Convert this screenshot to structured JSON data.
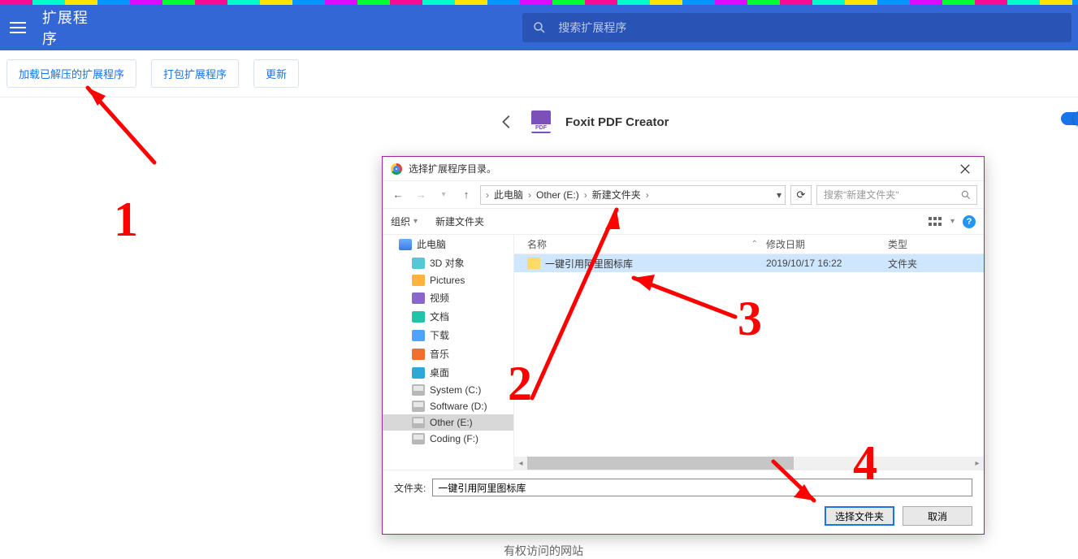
{
  "header": {
    "title": "扩展程序",
    "search_placeholder": "搜索扩展程序"
  },
  "action_bar": {
    "load_unpacked": "加载已解压的扩展程序",
    "pack": "打包扩展程序",
    "update": "更新"
  },
  "extension": {
    "name": "Foxit PDF Creator",
    "footer_text": "有权访问的网站"
  },
  "dialog": {
    "title": "选择扩展程序目录。",
    "path": {
      "seg1": "此电脑",
      "seg2": "Other (E:)",
      "seg3": "新建文件夹"
    },
    "search_placeholder": "搜索\"新建文件夹\"",
    "toolbar": {
      "organize": "组织",
      "new_folder": "新建文件夹"
    },
    "columns": {
      "name": "名称",
      "date": "修改日期",
      "type": "类型"
    },
    "tree": [
      {
        "icon": "ico-pc",
        "label": "此电脑",
        "indent": 1
      },
      {
        "icon": "ico-3d",
        "label": "3D 对象",
        "indent": 2
      },
      {
        "icon": "ico-pic",
        "label": "Pictures",
        "indent": 2
      },
      {
        "icon": "ico-vid",
        "label": "视频",
        "indent": 2
      },
      {
        "icon": "ico-doc",
        "label": "文档",
        "indent": 2
      },
      {
        "icon": "ico-dl",
        "label": "下载",
        "indent": 2
      },
      {
        "icon": "ico-mus",
        "label": "音乐",
        "indent": 2
      },
      {
        "icon": "ico-desk",
        "label": "桌面",
        "indent": 2
      },
      {
        "icon": "ico-drv",
        "label": "System (C:)",
        "indent": 2
      },
      {
        "icon": "ico-drv",
        "label": "Software (D:)",
        "indent": 2
      },
      {
        "icon": "ico-drv",
        "label": "Other (E:)",
        "indent": 2,
        "selected": true
      },
      {
        "icon": "ico-drv",
        "label": "Coding (F:)",
        "indent": 2
      }
    ],
    "rows": [
      {
        "name": "一键引用阿里图标库",
        "date": "2019/10/17 16:22",
        "type": "文件夹",
        "selected": true
      }
    ],
    "footer": {
      "folder_label": "文件夹:",
      "folder_value": "一键引用阿里图标库",
      "select_btn": "选择文件夹",
      "cancel_btn": "取消"
    }
  }
}
